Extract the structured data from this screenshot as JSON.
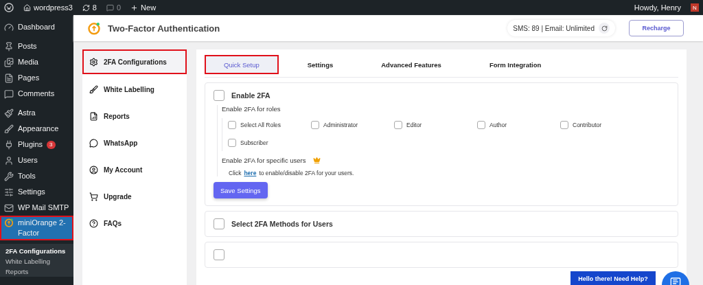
{
  "admin_bar": {
    "site": "wordpress3",
    "updates": "8",
    "comments": "0",
    "new": "New",
    "greeting": "Howdy, Henry",
    "avatar_initial": "N"
  },
  "menu": [
    [
      {
        "label": "Dashboard",
        "selected": false
      }
    ],
    [
      {
        "label": "Posts",
        "selected": false
      },
      {
        "label": "Media",
        "selected": false
      },
      {
        "label": "Pages",
        "selected": false
      },
      {
        "label": "Comments",
        "selected": false
      }
    ],
    [
      {
        "label": "Astra",
        "selected": false
      },
      {
        "label": "Appearance",
        "selected": false
      },
      {
        "label": "Plugins",
        "badge": "3",
        "selected": false
      },
      {
        "label": "Users",
        "selected": false
      },
      {
        "label": "Tools",
        "selected": false
      },
      {
        "label": "Settings",
        "selected": false
      },
      {
        "label": "WP Mail SMTP",
        "selected": false
      },
      {
        "label": "miniOrange 2-Factor",
        "selected": true
      }
    ]
  ],
  "submenu": [
    {
      "label": "2FA Configurations",
      "selected": true
    },
    {
      "label": "White Labelling",
      "selected": false
    },
    {
      "label": "Reports",
      "selected": false
    }
  ],
  "header": {
    "title": "Two-Factor Authentication",
    "credits": "SMS: 89 | Email: Unlimited",
    "recharge": "Recharge"
  },
  "plugin_nav": [
    {
      "label": "2FA Configurations",
      "selected": true
    },
    {
      "label": "White Labelling",
      "selected": false
    },
    {
      "label": "Reports",
      "selected": false
    },
    {
      "label": "WhatsApp",
      "selected": false
    },
    {
      "label": "My Account",
      "selected": false
    },
    {
      "label": "Upgrade",
      "selected": false
    },
    {
      "label": "FAQs",
      "selected": false
    }
  ],
  "tabs": [
    {
      "label": "Quick Setup",
      "selected": true
    },
    {
      "label": "Settings",
      "selected": false
    },
    {
      "label": "Advanced Features",
      "selected": false
    },
    {
      "label": "Form Integration",
      "selected": false
    }
  ],
  "enable_card": {
    "label": "Enable 2FA",
    "checked": false,
    "roles_heading": "Enable 2FA for roles",
    "roles": [
      {
        "label": "Select All Roles",
        "checked": false
      },
      {
        "label": "Administrator",
        "checked": false
      },
      {
        "label": "Editor",
        "checked": false
      },
      {
        "label": "Author",
        "checked": false
      },
      {
        "label": "Contributor",
        "checked": false
      },
      {
        "label": "Subscriber",
        "checked": false
      }
    ],
    "specific_heading": "Enable 2FA for specific users",
    "note_before": "Click",
    "link": "here",
    "note_after": "to enable/disable 2FA for your users.",
    "save": "Save Settings"
  },
  "methods_card": {
    "label": "Select 2FA Methods for Users",
    "checked": false
  },
  "next_card": {
    "checked": false
  },
  "help": {
    "label": "Hello there! Need Help?"
  }
}
